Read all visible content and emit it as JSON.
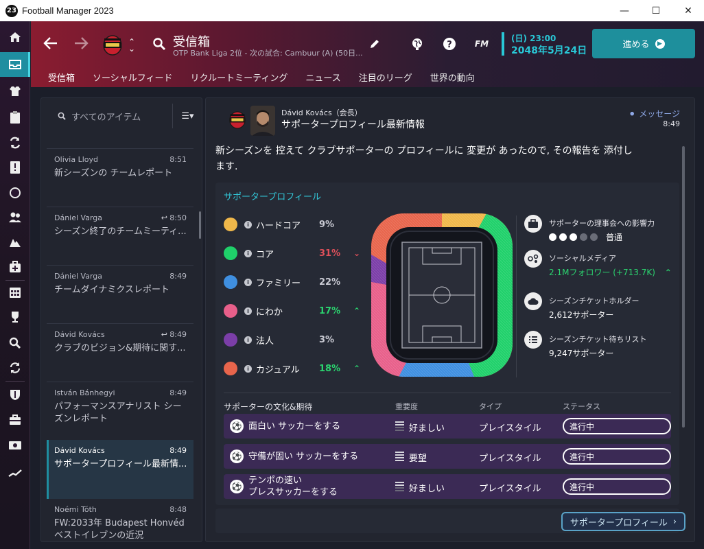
{
  "window": {
    "title": "Football Manager 2023",
    "icon_text": "23"
  },
  "header": {
    "page_title": "受信箱",
    "page_subtitle": "OTP Bank Liga 2位 - 次の試合: Cambuur (A) (50日...",
    "date_time": "(日) 23:00",
    "date_day": "2048年5月24日",
    "continue_label": "進める",
    "fm_label": "FM"
  },
  "tabs": [
    "受信箱",
    "ソーシャルフィード",
    "リクルートミーティング",
    "ニュース",
    "注目のリーグ",
    "世界の動向"
  ],
  "inbox": {
    "search_placeholder": "すべてのアイテム",
    "messages": [
      {
        "sender": "Olivia Lloyd",
        "time": "8:51",
        "subject": "新シーズンの チームレポート"
      },
      {
        "sender": "Dániel Varga",
        "time": "8:50",
        "subject": "シーズン終了のチームミーティ..."
      },
      {
        "sender": "Dániel Varga",
        "time": "8:49",
        "subject": "チームダイナミクスレポート"
      },
      {
        "sender": "Dávid Kovács",
        "time": "8:49",
        "subject": "クラブのビジョン&期待に関す..."
      },
      {
        "sender": "István Bánhegyi",
        "time": "8:49",
        "subject": "パフォーマンスアナリスト シーズンレポート"
      },
      {
        "sender": "Dávid Kovács",
        "time": "8:49",
        "subject": "サポータープロフィール最新情..."
      },
      {
        "sender": "Noémi Tóth",
        "time": "8:48",
        "subject": "FW:2033年 Budapest Honvéd ベストイレブンの近況"
      }
    ]
  },
  "message": {
    "from": "Dávid Kovács（会長）",
    "title": "サポータープロフィール最新情報",
    "message_link": "メッセージ",
    "time": "8:49",
    "body": "新シーズンを 控えて クラブサポーターの プロフィールに 変更が あったので, その報告を 添付します.",
    "profile_title": "サポータープロフィール",
    "segments": [
      {
        "name": "ハードコア",
        "pct": "9%",
        "color": "#f0b84a",
        "trend": ""
      },
      {
        "name": "コア",
        "pct": "31%",
        "color": "#1fd06a",
        "trend": "down"
      },
      {
        "name": "ファミリー",
        "pct": "22%",
        "color": "#3f8fe0",
        "trend": ""
      },
      {
        "name": "にわか",
        "pct": "17%",
        "color": "#e85f8a",
        "trend": "up"
      },
      {
        "name": "法人",
        "pct": "3%",
        "color": "#7b3ea8",
        "trend": ""
      },
      {
        "name": "カジュアル",
        "pct": "18%",
        "color": "#e8654c",
        "trend": "up"
      }
    ],
    "stats": {
      "influence_label": "サポーターの理事会への影響力",
      "influence_value": "普通",
      "influence_level": 3,
      "social_label": "ソーシャルメディア",
      "social_value": "2.1Mフォロワー (+713.7K)",
      "season_holders_label": "シーズンチケットホルダー",
      "season_holders_value": "2,612サポーター",
      "waitlist_label": "シーズンチケット待ちリスト",
      "waitlist_value": "9,247サポーター"
    },
    "expectations": {
      "header": "サポーターの文化&期待",
      "col_importance": "重要度",
      "col_type": "タイプ",
      "col_status": "ステータス",
      "rows": [
        {
          "name": "面白い サッカーをする",
          "importance": "好ましい",
          "type": "プレイスタイル",
          "status": "進行中"
        },
        {
          "name": "守備が固い サッカーをする",
          "importance": "要望",
          "type": "プレイスタイル",
          "status": "進行中"
        },
        {
          "name": "テンポの速い\nプレスサッカーをする",
          "importance": "好ましい",
          "type": "プレイスタイル",
          "status": "進行中"
        }
      ]
    },
    "footer_button": "サポータープロフィール"
  },
  "colors": {
    "accent": "#29c7d6",
    "up": "#2bd46f",
    "down": "#e0505a",
    "panel": "#22252f"
  }
}
